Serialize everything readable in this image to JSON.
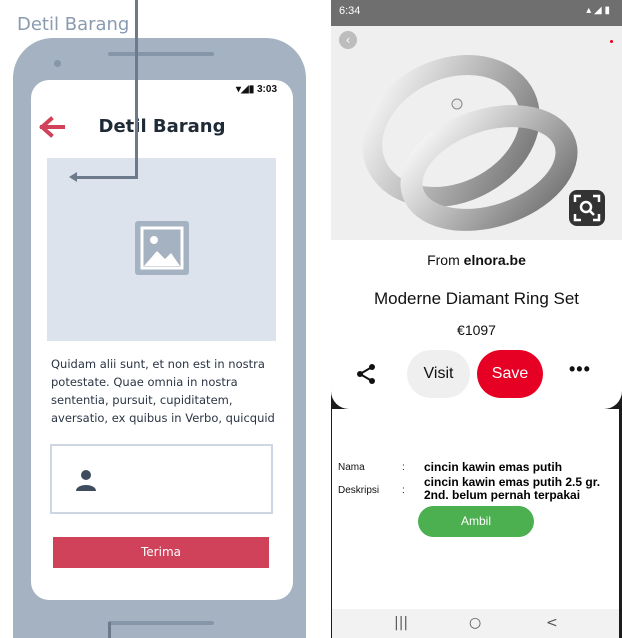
{
  "wireframe": {
    "title": "Detil Barang",
    "status_time": "3:03",
    "header_title": "Detil Barang",
    "description": "Quidam alii sunt, et non est in nostra potestate. Quae omnia in nostra sententia, pursuit, cupiditatem, aversatio, ex quibus in Verbo, quicquid",
    "button_label": "Terima",
    "colors": {
      "accent": "#d0425a",
      "frame": "#a4b2c1"
    }
  },
  "screenshot": {
    "status_time": "6:34",
    "source_prefix": "From",
    "source_site": "elnora.be",
    "product_title": "Moderne Diamant Ring Set",
    "price": "€1097",
    "visit_label": "Visit",
    "save_label": "Save",
    "more_label": "•••",
    "form": {
      "nama_label": "Nama",
      "nama_value": "cincin kawin emas putih",
      "deskripsi_label": "Deskripsi",
      "deskripsi_value": "cincin kawin emas putih 2.5 gr. 2nd. belum pernah terpakai",
      "separator": ":",
      "ambil_label": "Ambil"
    },
    "nav": {
      "recent": "|||",
      "home": "○",
      "back": "<"
    },
    "colors": {
      "save": "#e60023",
      "ambil": "#4caf50"
    }
  }
}
